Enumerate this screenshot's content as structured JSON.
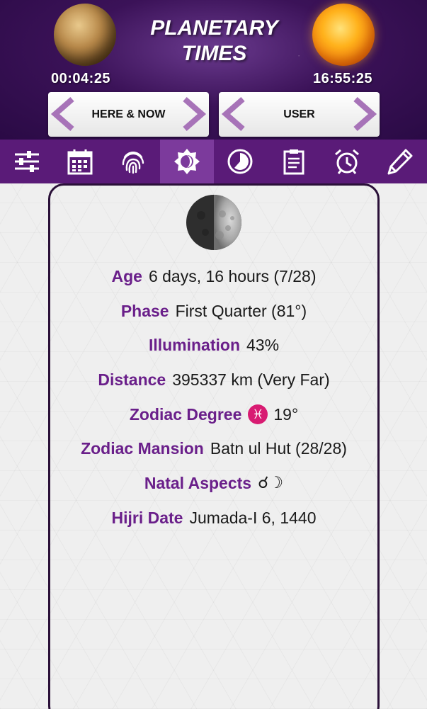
{
  "header": {
    "title_line1": "PLANETARY",
    "title_line2": "TIMES",
    "left_planet_time": "00:04:25",
    "right_planet_time": "16:55:25",
    "left_planet": "venus-planet",
    "right_planet": "sun-planet"
  },
  "switchers": [
    {
      "label": "HERE & NOW",
      "prev_icon": "chevron-left-icon",
      "next_icon": "chevron-right-icon"
    },
    {
      "label": "USER",
      "prev_icon": "chevron-left-icon",
      "next_icon": "chevron-right-icon"
    }
  ],
  "toolbar": {
    "items": [
      {
        "icon": "sliders-icon",
        "active": false
      },
      {
        "icon": "calendar-icon",
        "active": false
      },
      {
        "icon": "fingerprint-icon",
        "active": false
      },
      {
        "icon": "moon-phase-icon",
        "active": true
      },
      {
        "icon": "clock-icon",
        "active": false
      },
      {
        "icon": "clipboard-icon",
        "active": false
      },
      {
        "icon": "alarm-clock-icon",
        "active": false
      },
      {
        "icon": "pencil-icon",
        "active": false
      }
    ]
  },
  "moon": {
    "rows": [
      {
        "key": "Age",
        "value": "6 days, 16 hours (7/28)"
      },
      {
        "key": "Phase",
        "value": "First Quarter (81°)"
      },
      {
        "key": "Illumination",
        "value": "43%"
      },
      {
        "key": "Distance",
        "value": "395337 km (Very Far)"
      },
      {
        "key": "Zodiac Degree",
        "glyph": "♓",
        "value": "19°"
      },
      {
        "key": "Zodiac Mansion",
        "value": "Batn ul Hut (28/28)"
      },
      {
        "key": "Natal Aspects",
        "value": "☌☽"
      },
      {
        "key": "Hijri Date",
        "value": "Jumada-I 6, 1440"
      }
    ]
  },
  "colors": {
    "header_bg": "#3b1258",
    "toolbar_bg": "#5a1b78",
    "toolbar_active": "#7c3a9c",
    "key_text": "#6a1f8a",
    "arrow": "#a773b8",
    "pisces_badge": "#d81b72"
  }
}
